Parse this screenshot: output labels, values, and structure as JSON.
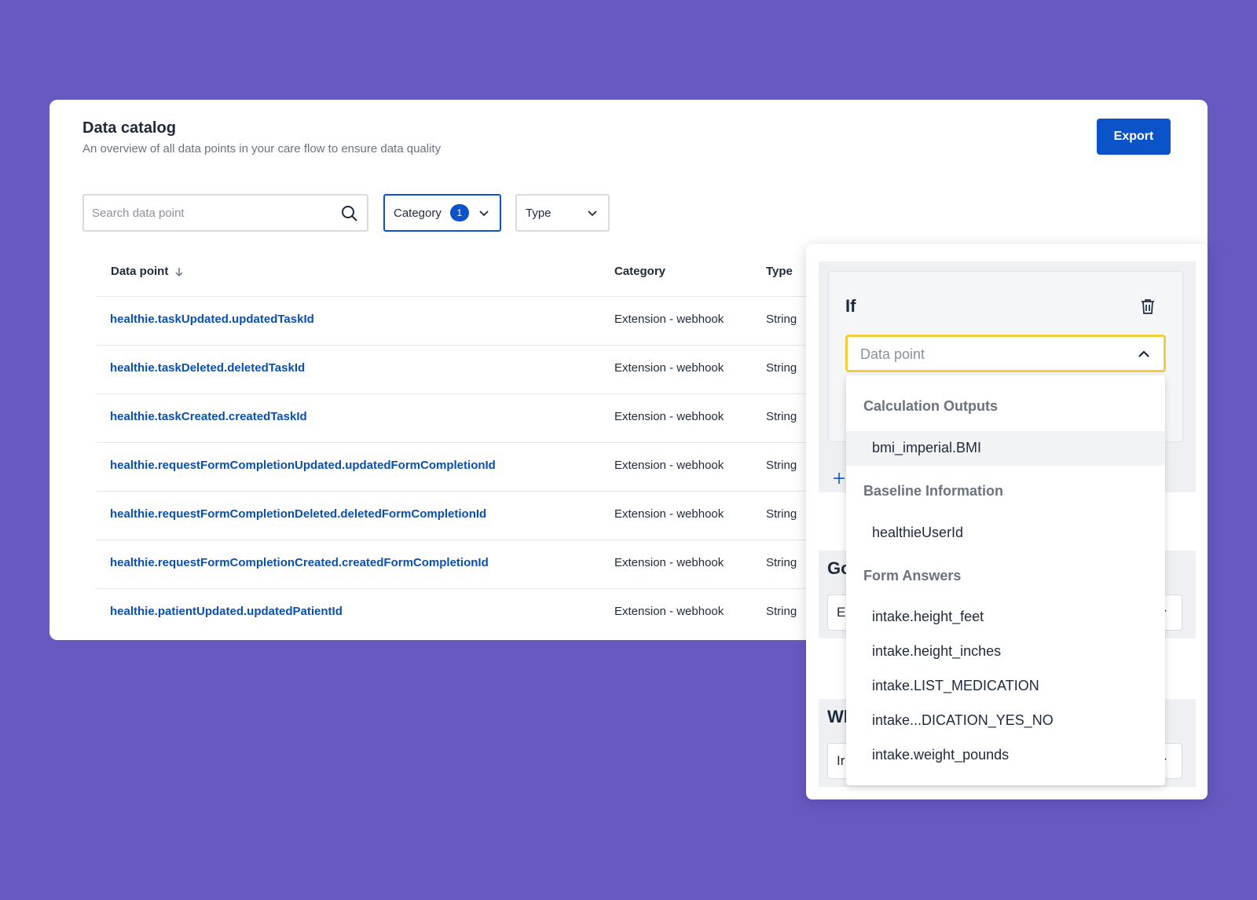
{
  "catalog": {
    "title": "Data catalog",
    "subtitle": "An overview of all data points in your care flow to ensure data quality",
    "export_label": "Export",
    "search_placeholder": "Search data point",
    "filters": {
      "category_label": "Category",
      "category_count": "1",
      "type_label": "Type"
    },
    "columns": {
      "data_point": "Data point",
      "category": "Category",
      "type": "Type"
    },
    "rows": [
      {
        "name": "healthie.taskUpdated.updatedTaskId",
        "category": "Extension - webhook",
        "type": "String"
      },
      {
        "name": "healthie.taskDeleted.deletedTaskId",
        "category": "Extension - webhook",
        "type": "String"
      },
      {
        "name": "healthie.taskCreated.createdTaskId",
        "category": "Extension - webhook",
        "type": "String"
      },
      {
        "name": "healthie.requestFormCompletionUpdated.updatedFormCompletionId",
        "category": "Extension - webhook",
        "type": "String"
      },
      {
        "name": "healthie.requestFormCompletionDeleted.deletedFormCompletionId",
        "category": "Extension - webhook",
        "type": "String"
      },
      {
        "name": "healthie.requestFormCompletionCreated.createdFormCompletionId",
        "category": "Extension - webhook",
        "type": "String"
      },
      {
        "name": "healthie.patientUpdated.updatedPatientId",
        "category": "Extension - webhook",
        "type": "String"
      }
    ]
  },
  "panel": {
    "if_label": "If",
    "data_point_placeholder": "Data point",
    "go_label_partial": "Go",
    "go_select_partial": "E",
    "wh_label_partial": "Wh",
    "wh_select_partial": "Ir",
    "dropdown": {
      "group_calc": "Calculation Outputs",
      "item_bmi": "bmi_imperial.BMI",
      "group_baseline": "Baseline Information",
      "item_healthie": "healthieUserId",
      "group_form": "Form Answers",
      "item_height_feet": "intake.height_feet",
      "item_height_inches": "intake.height_inches",
      "item_list_med": "intake.LIST_MEDICATION",
      "item_med_yes_no": "intake...DICATION_YES_NO",
      "item_weight": "intake.weight_pounds"
    }
  },
  "colors": {
    "background": "#6659c0",
    "primary": "#0a53c8",
    "link": "#0a4fb3",
    "focus_outline": "#f5cd3a"
  }
}
